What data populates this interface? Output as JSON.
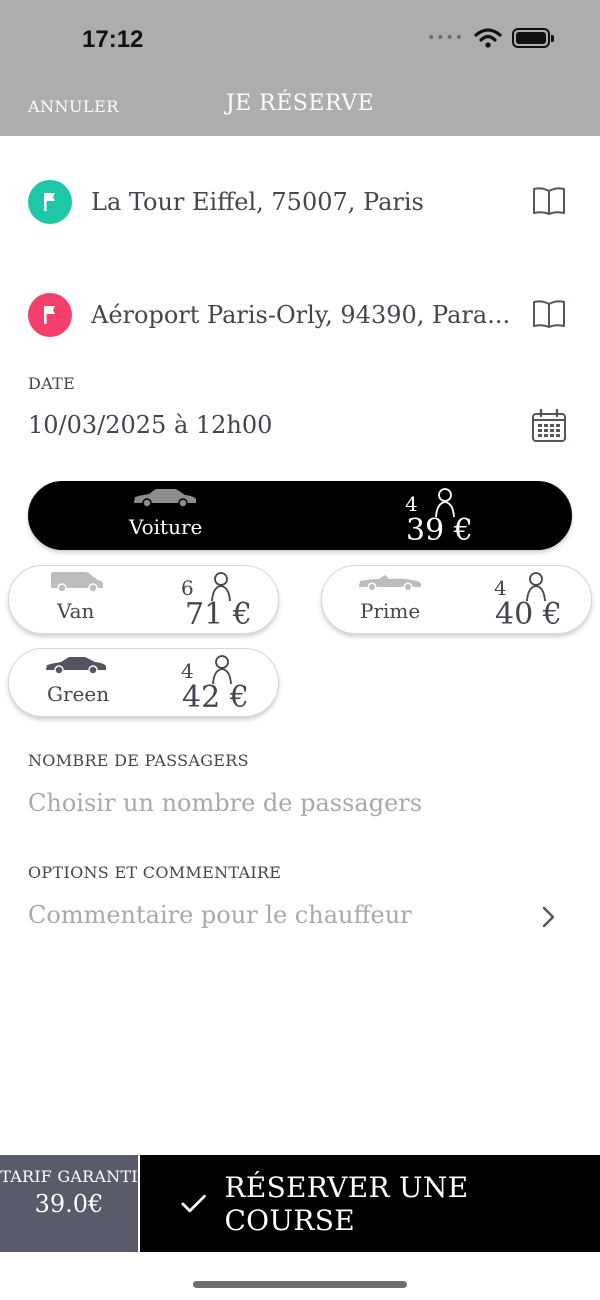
{
  "status_bar": {
    "time": "17:12",
    "signal": "••••"
  },
  "nav": {
    "cancel_label": "ANNULER",
    "title": "JE RÉSERVE"
  },
  "pickup": {
    "address": "La Tour Eiffel, 75007, Paris",
    "color": "#1ec7a5"
  },
  "dropoff": {
    "address": "Aéroport Paris-Orly, 94390, Para...",
    "color": "#f43f6c"
  },
  "date": {
    "label": "DATE",
    "value": "10/03/2025 à 12h00"
  },
  "vehicles": [
    {
      "name": "Voiture",
      "seats": "4",
      "price": "39 €",
      "selected": true
    },
    {
      "name": "Van",
      "seats": "6",
      "price": "71 €",
      "selected": false
    },
    {
      "name": "Prime",
      "seats": "4",
      "price": "40 €",
      "selected": false
    },
    {
      "name": "Green",
      "seats": "4",
      "price": "42 €",
      "selected": false
    }
  ],
  "passengers": {
    "label": "NOMBRE DE PASSAGERS",
    "placeholder": "Choisir un nombre de passagers"
  },
  "options": {
    "label": "OPTIONS ET COMMENTAIRE",
    "placeholder": "Commentaire pour le chauffeur"
  },
  "footer": {
    "tarif_label": "TARIF GARANTI",
    "tarif_value": "39.0€",
    "reserve_label": "RÉSERVER UNE COURSE"
  },
  "colors": {
    "header": "#adadad",
    "footer_left": "#595a6a",
    "selected_vehicle": "#000000"
  }
}
